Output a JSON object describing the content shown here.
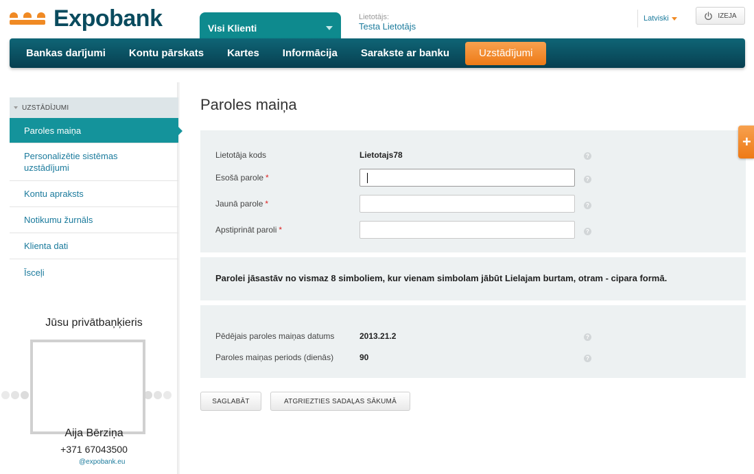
{
  "header": {
    "brand": "Expobank",
    "client_select": "Visi Klienti",
    "user_label": "Lietotājs:",
    "user_name": "Testa Lietotājs",
    "language": "Latviski",
    "logout": "IZEJA"
  },
  "nav": {
    "items": [
      "Bankas darījumi",
      "Kontu pārskats",
      "Kartes",
      "Informācija",
      "Sarakste ar banku",
      "Uzstādījumi"
    ],
    "active": "Uzstādījumi"
  },
  "sidebar": {
    "section": "UZSTĀDĪJUMI",
    "items": [
      {
        "label": "Paroles maiņa",
        "active": true
      },
      {
        "label": "Personalizētie sistēmas uzstādījumi",
        "active": false
      },
      {
        "label": "Kontu apraksts",
        "active": false
      },
      {
        "label": "Notikumu žurnāls",
        "active": false
      },
      {
        "label": "Klienta dati",
        "active": false
      },
      {
        "label": "Īsceļi",
        "active": false
      }
    ],
    "banker": {
      "title": "Jūsu privātbaņķieris",
      "name": "Aija Bērziņa",
      "phone": "+371 67043500",
      "email": "@expobank.eu"
    }
  },
  "main": {
    "title": "Paroles maiņa",
    "user_code_label": "Lietotāja kods",
    "user_code_value": "Lietotajs78",
    "current_password_label": "Esošā parole",
    "new_password_label": "Jaunā parole",
    "confirm_password_label": "Apstiprināt paroli",
    "required_mark": "*",
    "current_password_value": "",
    "new_password_value": "",
    "confirm_password_value": "",
    "help_glyph": "?",
    "notice": "Parolei jāsastāv no vismaz 8 simboliem, kur vienam simbolam jābūt Lielajam burtam, otram - cipara formā.",
    "last_change_label": "Pēdējais paroles maiņas datums",
    "last_change_value": "2013.21.2",
    "period_label": "Paroles maiņas periods (dienās)",
    "period_value": "90",
    "save_button": "SAGLABĀT",
    "back_button": "ATGRIEZTIES SADAĻAS SĀKUMĀ"
  },
  "float_button": "+",
  "colors": {
    "brand_dark": "#0a4b5e",
    "accent_orange": "#f08a24",
    "teal": "#14939b",
    "link": "#1a7a9c"
  }
}
